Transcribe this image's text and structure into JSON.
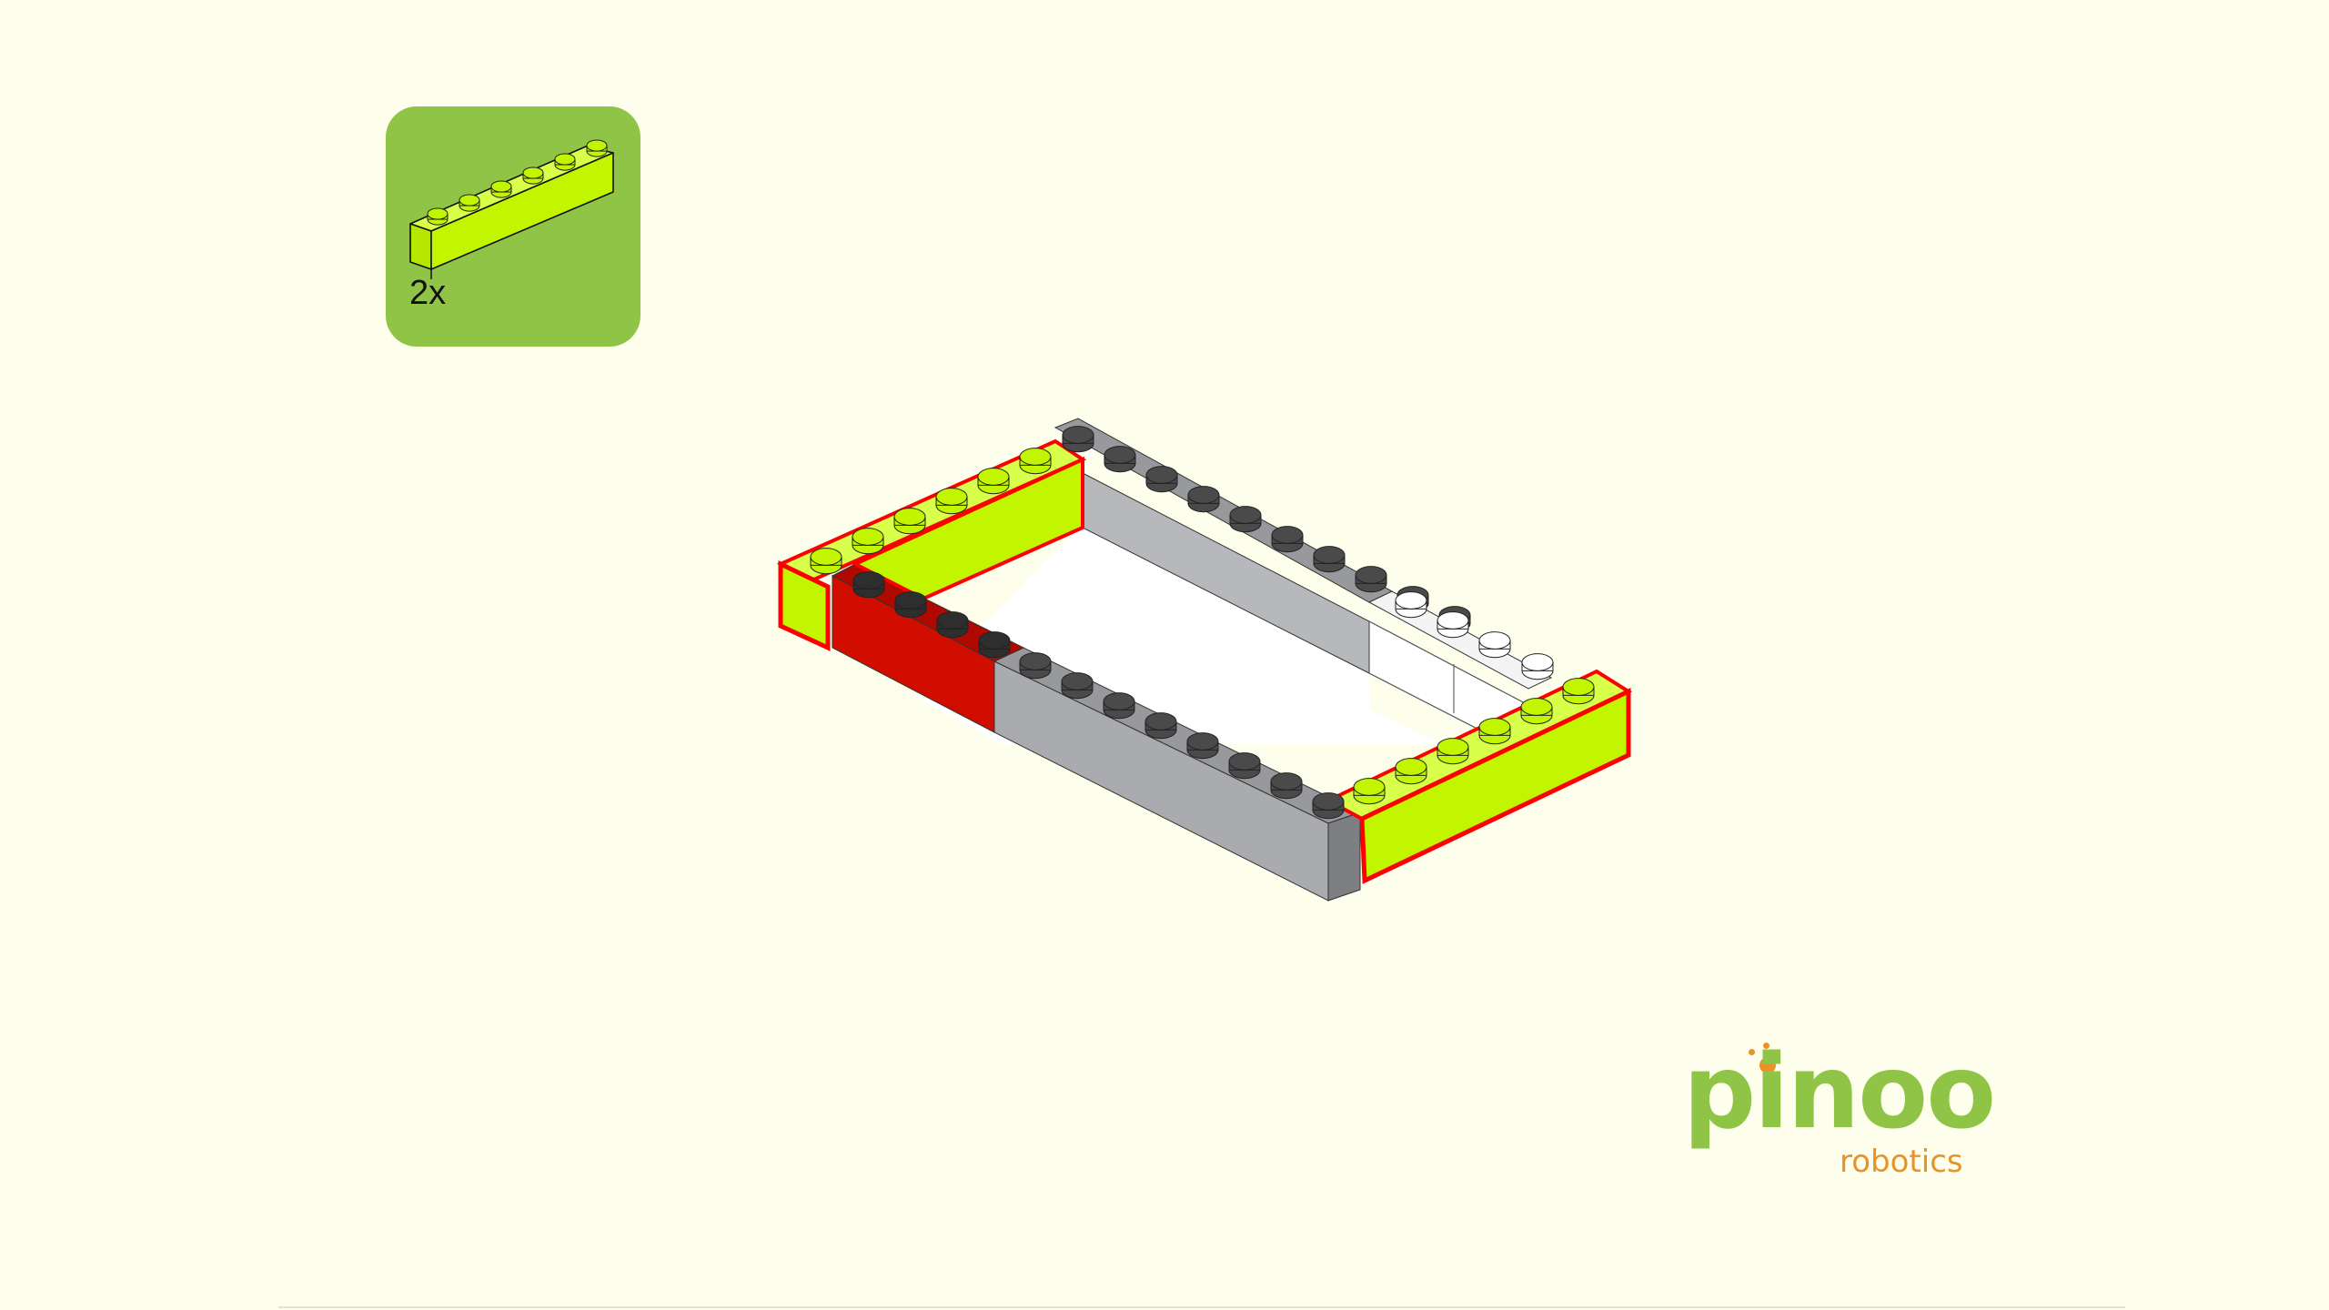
{
  "parts_list": {
    "quantity_label": "2x",
    "part_color": "#c1f600",
    "panel_color": "#8fc447",
    "part_studs": 6
  },
  "assembly": {
    "highlight_color": "#ff0000",
    "colors": {
      "lime": "#c1f600",
      "gray": "#a9abae",
      "red": "#d10d00",
      "white": "#ffffff"
    }
  },
  "logo": {
    "word": "pinoo",
    "subtitle": "robotics",
    "word_color": "#8fc447",
    "accent_color": "#e8932a"
  }
}
